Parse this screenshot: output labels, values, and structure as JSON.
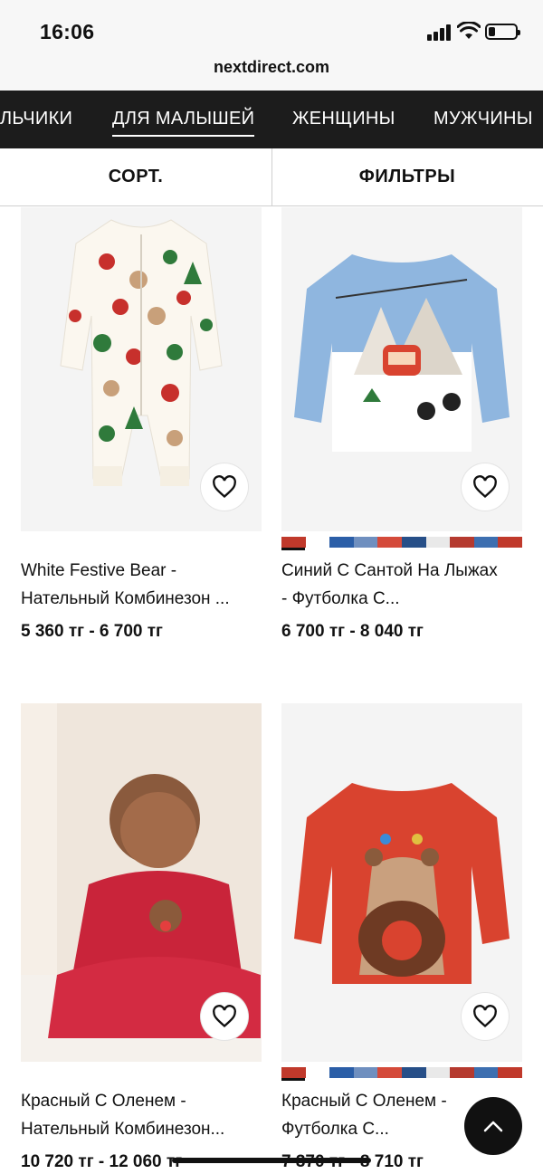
{
  "status": {
    "time": "16:06",
    "battery_level": 0.25
  },
  "browser": {
    "url": "nextdirect.com"
  },
  "nav": {
    "items": [
      "ЛЬЧИКИ",
      "ДЛЯ МАЛЫШЕЙ",
      "ЖЕНЩИНЫ",
      "МУЖЧИНЫ"
    ],
    "active": "ДЛЯ МАЛЫШЕЙ"
  },
  "toolbar": {
    "sort_label": "СОРТ.",
    "filter_label": "ФИЛЬТРЫ"
  },
  "products": [
    {
      "title_line1": "White Festive Bear -",
      "title_line2": "Нательный Комбинезон ...",
      "price": "5 360 тг - 6 700 тг",
      "image": "festive-bear-sleepsuit"
    },
    {
      "title_line1": "Синий С Сантой На Лыжах",
      "title_line2": "- Футболка С...",
      "price": "6 700 тг - 8 040 тг",
      "image": "blue-ski-lift-tshirt"
    },
    {
      "title_line1": "Красный С Оленем -",
      "title_line2": "Нательный Комбинезон...",
      "price": "10 720 тг - 12 060 тг",
      "image": "baby-red-reindeer-dress"
    },
    {
      "title_line1": "Красный С Оленем -",
      "title_line2": "Футболка С...",
      "price": "7 370 тг - 8 710 тг",
      "image": "red-reindeer-tshirt"
    }
  ],
  "colors": {
    "nav_bg": "#1c1c1c",
    "accent": "#111111",
    "swatches": [
      "#c0392b",
      "#2b5ea7",
      "#ffffff",
      "#6f8fbf",
      "#d44a3a",
      "#274f88",
      "#e9e9e9",
      "#b53a2f"
    ]
  }
}
